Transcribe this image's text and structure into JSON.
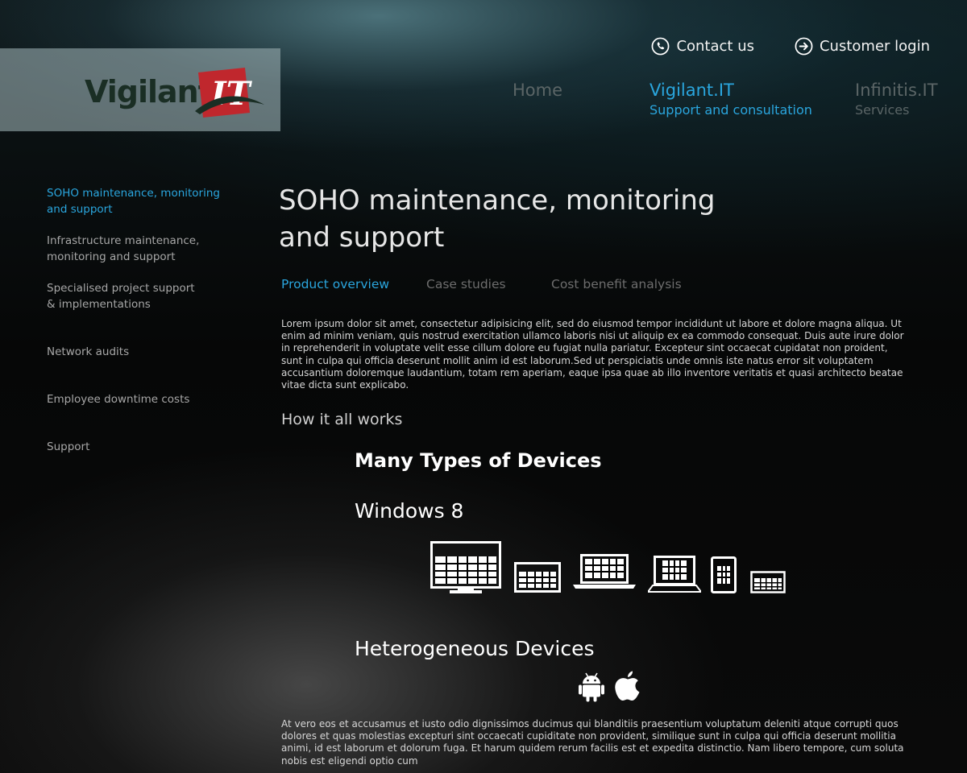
{
  "header": {
    "contact_label": "Contact us",
    "login_label": "Customer login",
    "logo_text": "Vigilant.",
    "logo_mark_text": "IT"
  },
  "nav": [
    {
      "title": "Home",
      "subtitle": ""
    },
    {
      "title": "Vigilant.IT",
      "subtitle": "Support and consultation"
    },
    {
      "title": "Infinitis.IT",
      "subtitle": "Services"
    }
  ],
  "sidebar": {
    "items": [
      {
        "label": "SOHO maintenance, monitoring\nand support"
      },
      {
        "label": "Infrastructure maintenance,\nmonitoring and support"
      },
      {
        "label": "Specialised project support\n& implementations"
      },
      {
        "label": "Network audits"
      },
      {
        "label": "Employee downtime costs"
      },
      {
        "label": "Support"
      }
    ]
  },
  "main": {
    "title": "SOHO maintenance, monitoring and support",
    "tabs": [
      {
        "label": "Product overview"
      },
      {
        "label": "Case studies"
      },
      {
        "label": "Cost benefit analysis"
      }
    ],
    "intro": "Lorem ipsum dolor sit amet, consectetur adipisicing elit, sed do eiusmod tempor incididunt ut labore et dolore magna aliqua. Ut enim ad minim veniam, quis nostrud exercitation ullamco laboris nisi ut aliquip ex ea commodo consequat. Duis aute irure dolor in reprehenderit in voluptate velit esse cillum dolore eu fugiat nulla pariatur. Excepteur sint occaecat cupidatat non proident, sunt in culpa qui officia deserunt mollit anim id est laborum.Sed ut perspiciatis unde omnis iste natus error sit voluptatem accusantium doloremque laudantium, totam rem aperiam, eaque ipsa quae ab illo inventore veritatis et quasi architecto beatae vitae dicta sunt explicabo.",
    "section_heading": "How it all works",
    "devices_heading": "Many Types of Devices",
    "windows_heading": "Windows 8",
    "hetero_heading": "Heterogeneous Devices",
    "outro": "At vero eos et accusamus et iusto odio dignissimos ducimus qui blanditiis praesentium voluptatum deleniti atque corrupti quos dolores et quas molestias excepturi sint occaecati cupiditate non provident, similique sunt in culpa qui officia deserunt mollitia animi, id est laborum et dolorum fuga. Et harum quidem rerum facilis est et expedita distinctio. Nam libero tempore, cum soluta nobis est eligendi optio cum"
  },
  "devices": [
    {
      "icon": "monitor-icon"
    },
    {
      "icon": "tablet-landscape-icon"
    },
    {
      "icon": "laptop-icon"
    },
    {
      "icon": "notebook-icon"
    },
    {
      "icon": "phone-icon"
    },
    {
      "icon": "small-tablet-icon"
    }
  ],
  "os_icons": [
    {
      "icon": "android-icon"
    },
    {
      "icon": "apple-icon"
    }
  ],
  "colors": {
    "accent": "#2aa6de",
    "logo_red": "#c0272d",
    "nav_inactive": "#5b6566"
  }
}
